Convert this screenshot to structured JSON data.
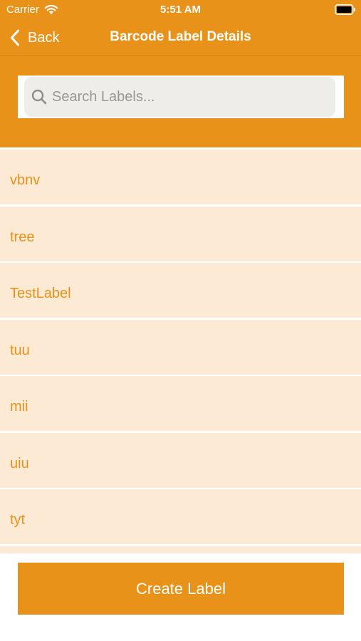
{
  "status_bar": {
    "carrier": "Carrier",
    "time": "5:51 AM",
    "wifi_icon": "wifi-icon",
    "battery_icon": "battery-icon"
  },
  "nav": {
    "back_label": "Back",
    "back_icon": "chevron-left-icon",
    "title": "Barcode Label Details"
  },
  "search": {
    "placeholder": "Search Labels...",
    "value": "",
    "icon": "search-icon"
  },
  "labels": [
    "vbnv",
    "tree",
    "TestLabel",
    "tuu",
    "mii",
    "uiu",
    "tyt"
  ],
  "footer": {
    "create_label": "Create Label"
  },
  "colors": {
    "accent": "#E8921A",
    "row_background": "#FDEAD4",
    "search_field": "#EFEDEA"
  }
}
